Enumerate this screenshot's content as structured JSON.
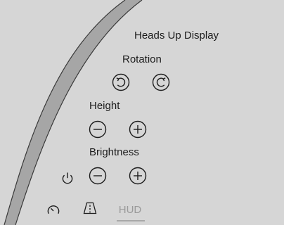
{
  "panel": {
    "title": "Heads Up Display",
    "rotation_label": "Rotation",
    "height_label": "Height",
    "brightness_label": "Brightness"
  },
  "tabs": [
    {
      "icon": "speedometer-icon"
    },
    {
      "icon": "road-sign-icon"
    },
    {
      "label": "HUD"
    }
  ],
  "colors": {
    "background": "#d6d6d6",
    "band": "#a6a6a6",
    "text": "#1c1c1c",
    "inactive_tab": "#9a9a9a"
  }
}
